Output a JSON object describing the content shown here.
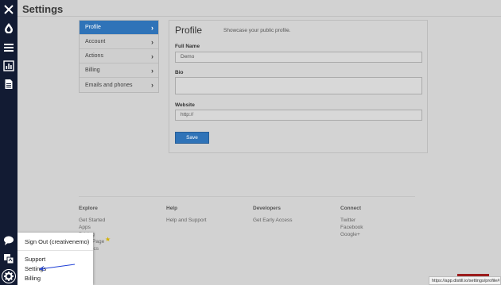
{
  "header": {
    "title": "Settings"
  },
  "rail": {
    "icons": [
      "close-icon",
      "drop-icon",
      "list-icon",
      "chart-icon",
      "document-icon",
      "chat-icon",
      "translate-icon",
      "gear-icon"
    ]
  },
  "settings_nav": {
    "items": [
      {
        "label": "Profile",
        "active": true
      },
      {
        "label": "Account",
        "active": false
      },
      {
        "label": "Actions",
        "active": false
      },
      {
        "label": "Billing",
        "active": false
      },
      {
        "label": "Emails and phones",
        "active": false
      }
    ]
  },
  "profile": {
    "title": "Profile",
    "subtitle": "Showcase your public profile.",
    "full_name_label": "Full Name",
    "full_name_value": "Demo",
    "bio_label": "Bio",
    "bio_value": "",
    "website_label": "Website",
    "website_value": "http://",
    "save_label": "Save"
  },
  "footer": {
    "explore": {
      "heading": "Explore",
      "links": [
        "Get Started",
        "Apps",
        "Pricing",
        "Page",
        "ics"
      ]
    },
    "help": {
      "heading": "Help",
      "links": [
        "Help and Support"
      ]
    },
    "developers": {
      "heading": "Developers",
      "links": [
        "Get Early Access"
      ]
    },
    "connect": {
      "heading": "Connect",
      "links": [
        "Twitter",
        "Facebook",
        "Google+"
      ]
    }
  },
  "popup_menu": {
    "sign_out": "Sign Out (creativenemo)",
    "support": "Support",
    "settings": "Settings",
    "billing": "Billing"
  },
  "status_url": "https://app.distill.io/settings/profile#",
  "colors": {
    "accent": "#2f73b8",
    "rail": "#121b33"
  }
}
